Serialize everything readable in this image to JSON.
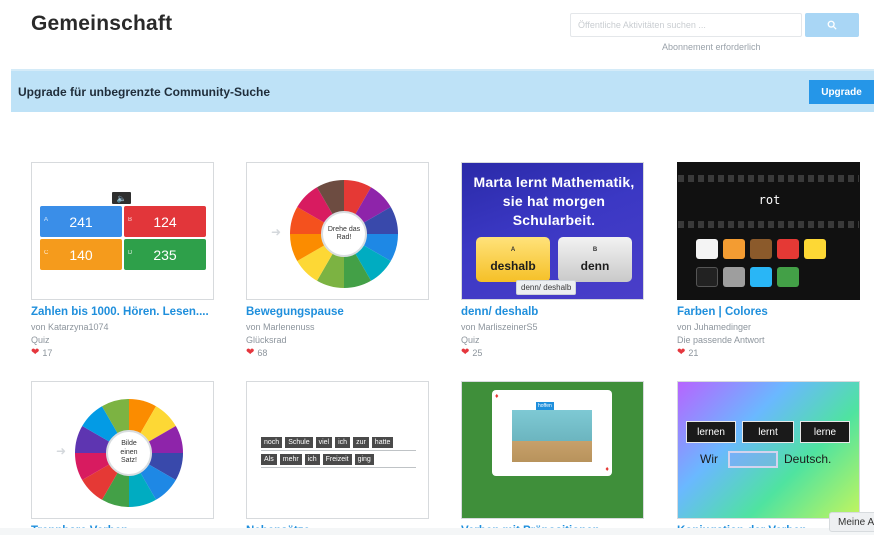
{
  "header": {
    "title": "Gemeinschaft",
    "search_placeholder": "Öffentliche Aktivitäten suchen ...",
    "search_note": "Abonnement erforderlich"
  },
  "banner": {
    "text": "Upgrade für unbegrenzte Community-Suche",
    "button_label": "Upgrade"
  },
  "colors": {
    "accent": "#2596e8",
    "link": "#1f8fdc",
    "banner_bg": "#bee2f7",
    "heart": "#e5363d"
  },
  "cards": [
    {
      "title": "Zahlen bis 1000. Hören. Lesen....",
      "author": "von Katarzyna1074",
      "type": "Quiz",
      "likes": "17",
      "thumb": {
        "tiles": [
          {
            "letter": "A",
            "value": "241",
            "color": "#3a8ee8"
          },
          {
            "letter": "B",
            "value": "124",
            "color": "#e2363a"
          },
          {
            "letter": "C",
            "value": "140",
            "color": "#f59b1c"
          },
          {
            "letter": "D",
            "value": "235",
            "color": "#2ea04a"
          }
        ]
      }
    },
    {
      "title": "Bewegungspause",
      "author": "von Marlenenuss",
      "type": "Glücksrad",
      "likes": "68",
      "thumb": {
        "center_text": "Drehe das Rad!"
      }
    },
    {
      "title": "denn/ deshalb",
      "author": "von MarliszeinerS5",
      "type": "Quiz",
      "likes": "25",
      "thumb": {
        "headline": "Marta lernt Mathematik, sie hat morgen Schularbeit.",
        "answer_a": "deshalb",
        "answer_b": "denn",
        "letter_a": "A",
        "letter_b": "B",
        "tooltip": "denn/ deshalb"
      }
    },
    {
      "title": "Farben | Colores",
      "author": "von Juhamedinger",
      "type": "Die passende Antwort",
      "likes": "21",
      "thumb": {
        "word": "rot"
      }
    },
    {
      "title": "Trennbare Verben",
      "thumb": {
        "center_text": "Bilde einen Satz!"
      }
    },
    {
      "title": "Nebensätze",
      "thumb": {
        "row1": [
          "noch",
          "Schule",
          "viel",
          "ich",
          "zur",
          "hatte"
        ],
        "row2": [
          "Als",
          "mehr",
          "ich",
          "Freizeit",
          "ging"
        ]
      }
    },
    {
      "title": "Verben mit Präpositionen",
      "thumb": {
        "word": "hoffen"
      }
    },
    {
      "title": "Konjugation der Verben",
      "thumb": {
        "options": [
          "lernen",
          "lernt",
          "lerne"
        ],
        "sentence_start": "Wir",
        "sentence_end": "Deutsch."
      }
    }
  ],
  "floating": {
    "label": "Meine A"
  }
}
